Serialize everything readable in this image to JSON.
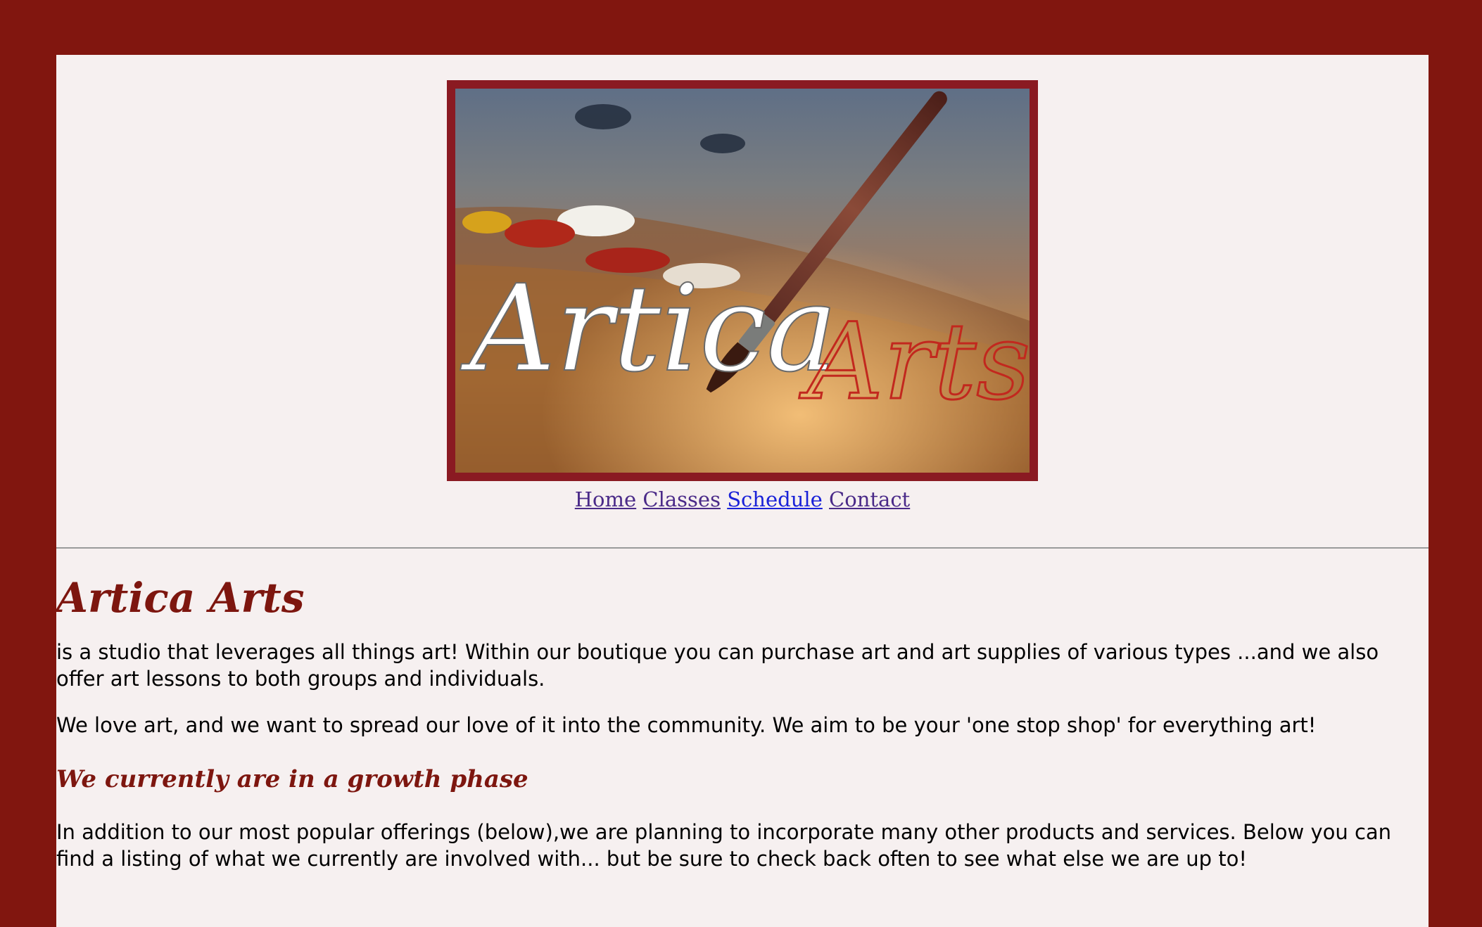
{
  "colors": {
    "outer_background": "#81160f",
    "page_background": "#f6f0f0",
    "heading": "#7d160f",
    "banner_border": "#8a1a22",
    "nav_link": "#4a2a88",
    "nav_link_current": "#1a22d8"
  },
  "banner": {
    "logo_word_1": "Artica",
    "logo_word_2": "Arts"
  },
  "nav": {
    "items": [
      "Home",
      "Classes",
      "Schedule",
      "Contact"
    ]
  },
  "main": {
    "title": "Artica Arts",
    "intro": "is a studio that leverages all things art! Within our boutique you can purchase art and art supplies of various types ...and we also offer art lessons to both groups and individuals.",
    "mission": "We love art, and we want to spread our love of it into the community. We aim to be your 'one stop shop' for everything art!",
    "growth_heading": "We currently are in a growth phase",
    "growth_text": "In addition to our most popular offerings (below),we are planning to incorporate many other products and services. Below you can find a listing of what we currently are involved with... but be sure to check back often to see what else we are up to!"
  }
}
